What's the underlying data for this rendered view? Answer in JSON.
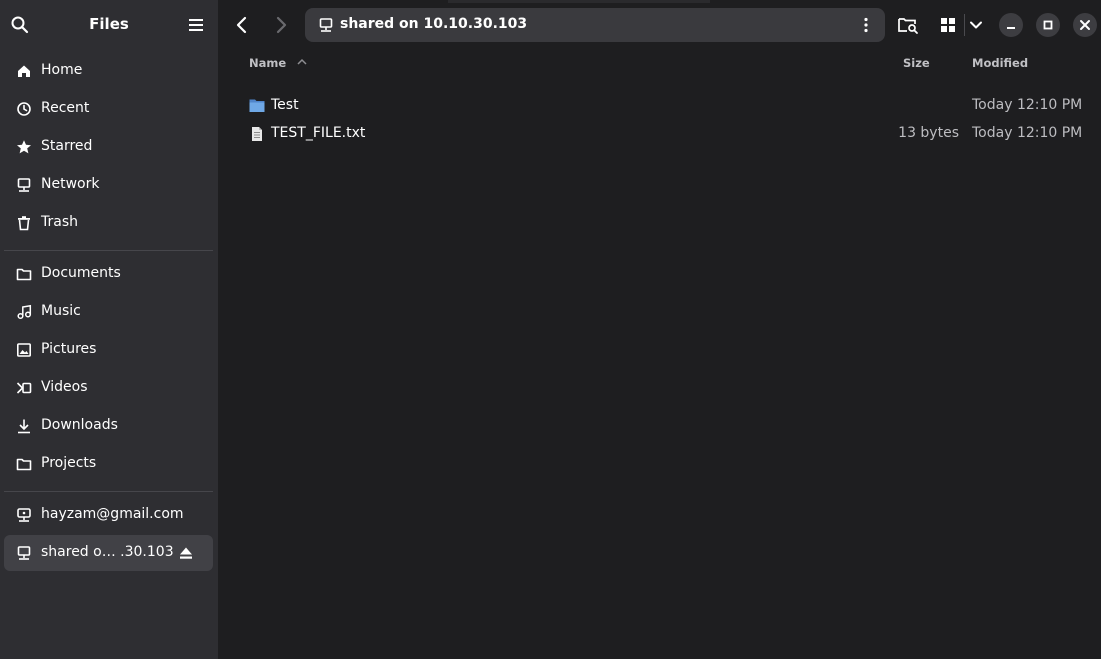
{
  "sidebar": {
    "title": "Files",
    "places": [
      {
        "label": "Home",
        "icon": "home-icon"
      },
      {
        "label": "Recent",
        "icon": "clock-icon"
      },
      {
        "label": "Starred",
        "icon": "star-icon"
      },
      {
        "label": "Network",
        "icon": "network-icon"
      },
      {
        "label": "Trash",
        "icon": "trash-icon"
      }
    ],
    "bookmarks": [
      {
        "label": "Documents",
        "icon": "folder-documents-icon"
      },
      {
        "label": "Music",
        "icon": "music-icon"
      },
      {
        "label": "Pictures",
        "icon": "pictures-icon"
      },
      {
        "label": "Videos",
        "icon": "videos-icon"
      },
      {
        "label": "Downloads",
        "icon": "downloads-icon"
      },
      {
        "label": "Projects",
        "icon": "folder-icon"
      }
    ],
    "mounts": [
      {
        "label": "hayzam@gmail.com",
        "icon": "online-account-icon"
      },
      {
        "label": "shared o… .30.103",
        "icon": "network-share-icon",
        "active": true
      }
    ]
  },
  "pathbar": {
    "location": "shared on 10.10.30.103"
  },
  "columns": {
    "name": "Name",
    "size": "Size",
    "modified": "Modified"
  },
  "files": [
    {
      "name": "Test",
      "size": "",
      "modified": "Today 12:10 PM",
      "icon": "folder-icon"
    },
    {
      "name": "TEST_FILE.txt",
      "size": "13 bytes",
      "modified": "Today 12:10 PM",
      "icon": "text-file-icon"
    }
  ],
  "colors": {
    "sidebar_bg": "#2e2e32",
    "content_bg": "#1e1e20",
    "folder_blue": "#6fa8e6"
  }
}
